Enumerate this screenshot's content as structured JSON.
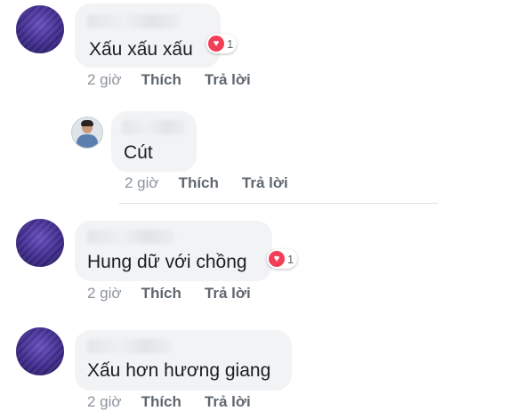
{
  "comments": [
    {
      "text": "Xấu xấu xấu",
      "reaction_icon": "heart-icon",
      "reaction_count": "1",
      "time": "2 giờ",
      "like_label": "Thích",
      "reply_label": "Trả lời"
    },
    {
      "text": "Cút",
      "time": "2 giờ",
      "like_label": "Thích",
      "reply_label": "Trả lời"
    },
    {
      "text": "Hung dữ với chồng",
      "reaction_icon": "heart-icon",
      "reaction_count": "1",
      "time": "2 giờ",
      "like_label": "Thích",
      "reply_label": "Trả lời"
    },
    {
      "text": "Xấu hơn hương giang",
      "time": "2 giờ",
      "like_label": "Thích",
      "reply_label": "Trả lời"
    }
  ],
  "colors": {
    "bubble": "#f2f3f5",
    "heart": "#f33e58",
    "meta": "#606770"
  }
}
